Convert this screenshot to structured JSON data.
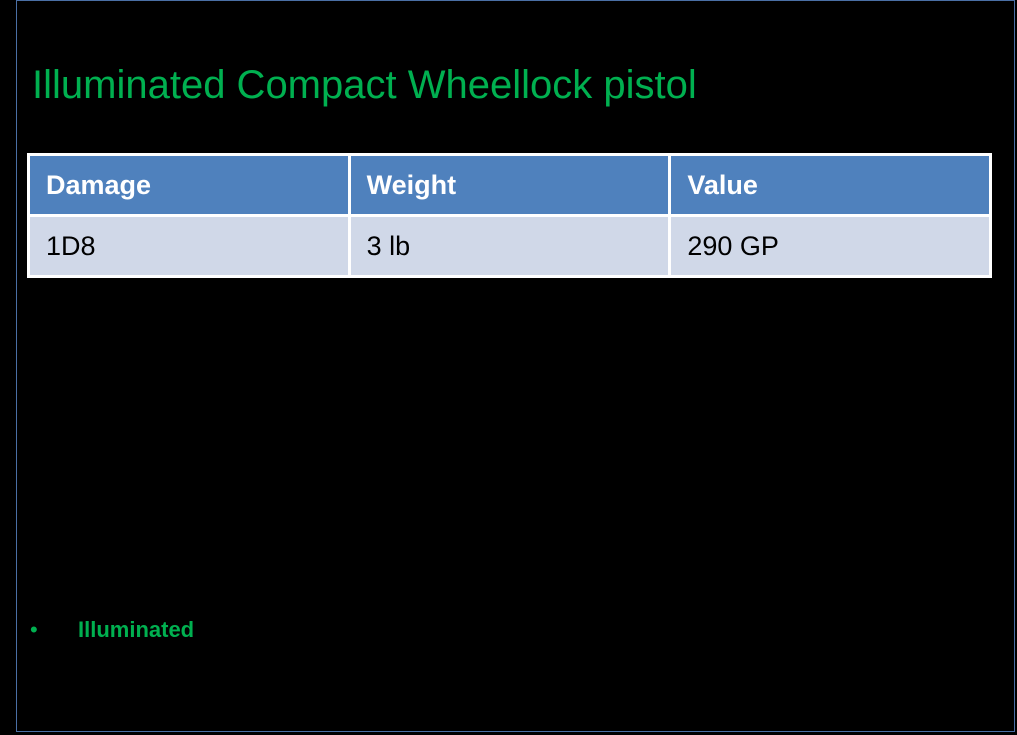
{
  "page": {
    "title": "Illuminated Compact Wheellock pistol"
  },
  "stats_table": {
    "headers": [
      "Damage",
      "Weight",
      "Value"
    ],
    "row": [
      "1D8",
      "3 lb",
      "290 GP"
    ]
  },
  "properties": {
    "bullet": "•",
    "items": [
      "Illuminated"
    ]
  },
  "colors": {
    "background": "#000000",
    "title": "#00b050",
    "header_fill": "#4f81bd",
    "row_fill": "#d0d8e8",
    "frame_border": "#4a6fa5"
  }
}
